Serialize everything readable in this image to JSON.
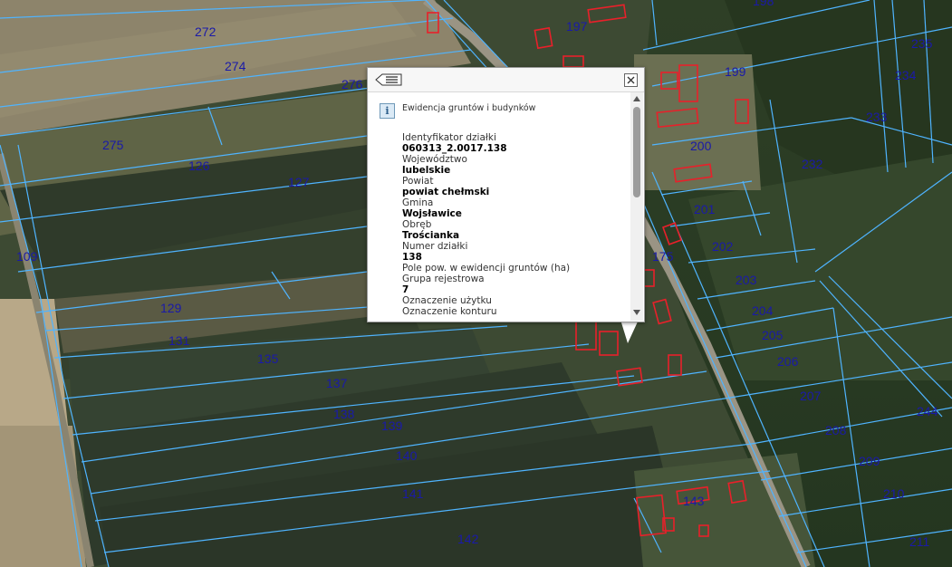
{
  "map": {
    "parcel_numbers": [
      "272",
      "274",
      "276",
      "275",
      "126",
      "127",
      "109",
      "129",
      "131",
      "135",
      "137",
      "138",
      "139",
      "140",
      "141",
      "142",
      "197",
      "198",
      "199",
      "200",
      "201",
      "202",
      "203",
      "204",
      "205",
      "206",
      "207",
      "208",
      "209",
      "210",
      "211",
      "175",
      "143",
      "232",
      "233",
      "234",
      "235",
      "244"
    ],
    "colors": {
      "parcel_line": "#4fb4ff",
      "parcel_label": "#1a1aa8",
      "building_outline": "#e8202a"
    }
  },
  "popup": {
    "section_title": "Ewidencja gruntów i budynków",
    "info_icon": "i",
    "list_button_icon": "list-icon",
    "close_button_icon": "close-icon",
    "fields": [
      {
        "label": "Identyfikator działki",
        "value": "060313_2.0017.138"
      },
      {
        "label": "Województwo",
        "value": "lubelskie"
      },
      {
        "label": "Powiat",
        "value": "powiat chełmski"
      },
      {
        "label": "Gmina",
        "value": "Wojsławice"
      },
      {
        "label": "Obręb",
        "value": "Trościanka"
      },
      {
        "label": "Numer działki",
        "value": "138"
      },
      {
        "label": "Pole pow. w ewidencji gruntów (ha)",
        "value": ""
      },
      {
        "label": "Grupa rejestrowa",
        "value": "7"
      },
      {
        "label": "Oznaczenie użytku",
        "value": ""
      },
      {
        "label": "Oznaczenie konturu",
        "value": ""
      }
    ]
  }
}
